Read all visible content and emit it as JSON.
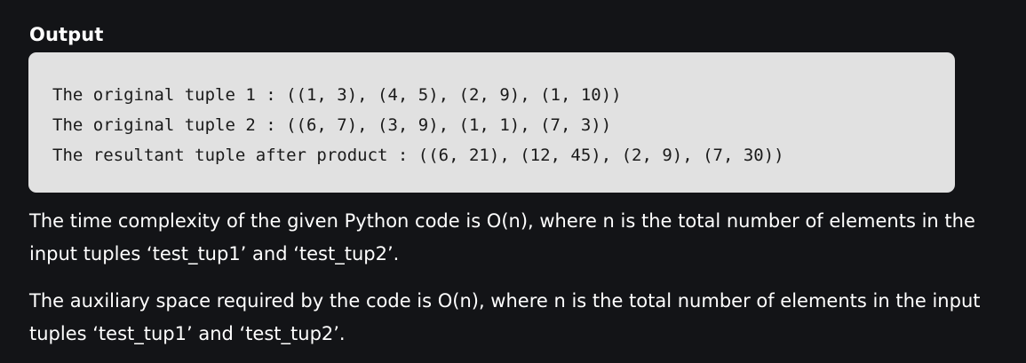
{
  "section": {
    "heading": "Output"
  },
  "code_output": {
    "lines": [
      "The original tuple 1 : ((1, 3), (4, 5), (2, 9), (1, 10))",
      "The original tuple 2 : ((6, 7), (3, 9), (1, 1), (7, 3))",
      "The resultant tuple after product : ((6, 21), (12, 45), (2, 9), (7, 30))"
    ]
  },
  "paragraphs": [
    "The time complexity of the given Python code is O(n), where n is the total number of elements in the input tuples ‘test_tup1’ and ‘test_tup2’.",
    "The auxiliary space required by the code is O(n), where n is the total number of elements in the input tuples ‘test_tup1’ and ‘test_tup2’."
  ],
  "colors": {
    "page_background": "#131417",
    "code_background": "#e1e1e1",
    "code_text": "#1a1a1a",
    "body_text": "#ffffff"
  }
}
